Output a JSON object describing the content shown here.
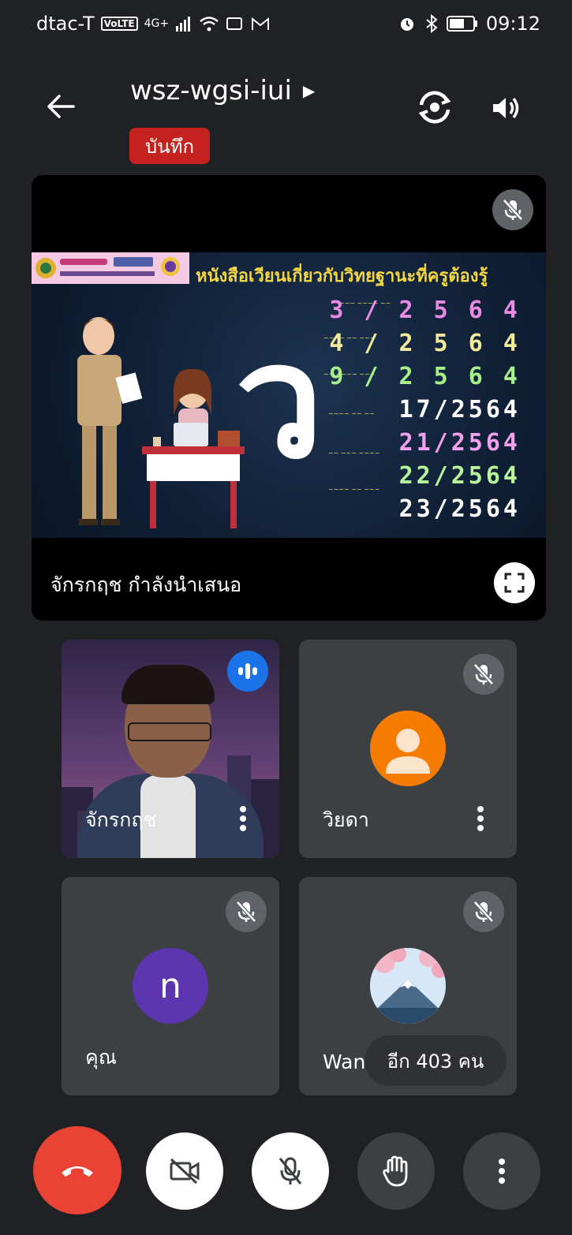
{
  "status_bar": {
    "carrier": "dtac-T",
    "volte": "VoLTE",
    "network": "4G+",
    "time": "09:12"
  },
  "header": {
    "meeting_code": "wsz-wgsi-iui",
    "recording_label": "บันทึก"
  },
  "presentation": {
    "slide_title": "หนังสือเวียนเกี่ยวกับวิทยฐานะที่ครูต้องรู้",
    "slide_big_char": "ว",
    "slide_numbers": [
      "3 / 2 5 6 4",
      "4 / 2 5 6 4",
      "9 / 2 5 6 4",
      "17/2564",
      "21/2564",
      "22/2564",
      "23/2564"
    ],
    "presenter_label": "จักรกฤช กำลังนำเสนอ"
  },
  "participants": [
    {
      "name": "จักรกฤช",
      "state": "speaking"
    },
    {
      "name": "วิยดา",
      "state": "muted",
      "avatar_color": "#f57c00"
    },
    {
      "name": "คุณ",
      "state": "muted",
      "avatar_color": "#5e35b1",
      "initial": "n"
    },
    {
      "name": "Wani",
      "state": "muted"
    }
  ],
  "others_count_label": "อีก 403 คน",
  "colors": {
    "background": "#202124",
    "tile": "#3c4043",
    "hangup": "#ea4335",
    "record": "#c5221f",
    "speaking": "#1a73e8"
  },
  "icons": {
    "back": "arrow-left-icon",
    "camera_switch": "camera-flip-icon",
    "speaker": "speaker-icon",
    "mic_off": "mic-off-icon",
    "fullscreen": "fullscreen-icon",
    "more": "more-vert-icon",
    "hangup": "call-end-icon",
    "camera_off": "videocam-off-icon",
    "raise_hand": "hand-icon"
  }
}
